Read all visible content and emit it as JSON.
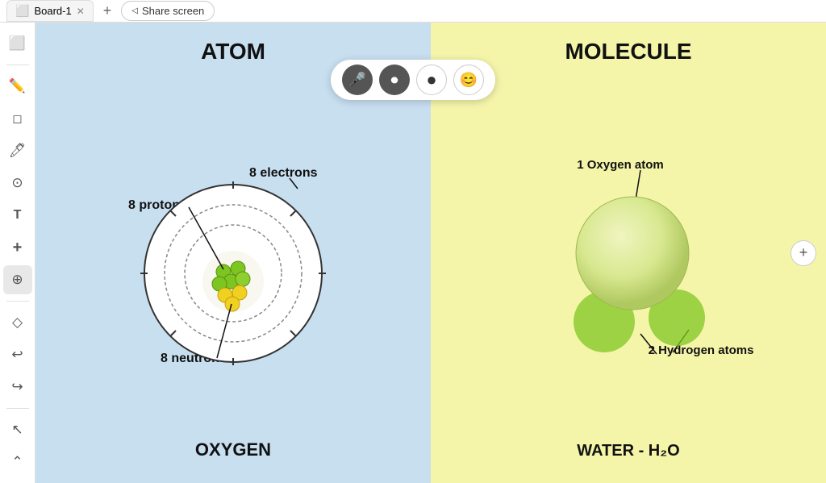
{
  "topbar": {
    "tab_label": "Board-1",
    "tab_icon": "⬜",
    "share_label": "Share screen",
    "add_tab": "+"
  },
  "media_controls": {
    "mic_icon": "🎤",
    "video_icon": "⏺",
    "dot_icon": "●",
    "emoji_icon": "😊"
  },
  "sidebar": {
    "tools": [
      {
        "name": "board-icon",
        "icon": "⬜"
      },
      {
        "name": "pencil-icon",
        "icon": "✏️"
      },
      {
        "name": "eraser-icon",
        "icon": "◻"
      },
      {
        "name": "pen-icon",
        "icon": "🖊"
      },
      {
        "name": "circle-icon",
        "icon": "⊙"
      },
      {
        "name": "text-icon",
        "icon": "T"
      },
      {
        "name": "plus-icon",
        "icon": "+"
      },
      {
        "name": "move-icon",
        "icon": "⊕"
      },
      {
        "name": "clear-icon",
        "icon": "◇"
      },
      {
        "name": "undo-icon",
        "icon": "↩"
      },
      {
        "name": "redo-icon",
        "icon": "↪"
      },
      {
        "name": "pointer-icon",
        "icon": "↖"
      },
      {
        "name": "expand-icon",
        "icon": "⌃"
      }
    ]
  },
  "atom_panel": {
    "title": "ATOM",
    "subtitle": "OXYGEN",
    "label_protons": "8 protons",
    "label_electrons": "8 electrons",
    "label_neutrons": "8 neutrons",
    "bg_color": "#c8dff0"
  },
  "molecule_panel": {
    "title": "MOLECULE",
    "subtitle": "WATER - H₂O",
    "label_oxygen": "1 Oxygen atom",
    "label_hydrogen": "2 Hydrogen atoms",
    "bg_color": "#f5f5aa"
  },
  "zoom": {
    "btn_label": "+"
  }
}
